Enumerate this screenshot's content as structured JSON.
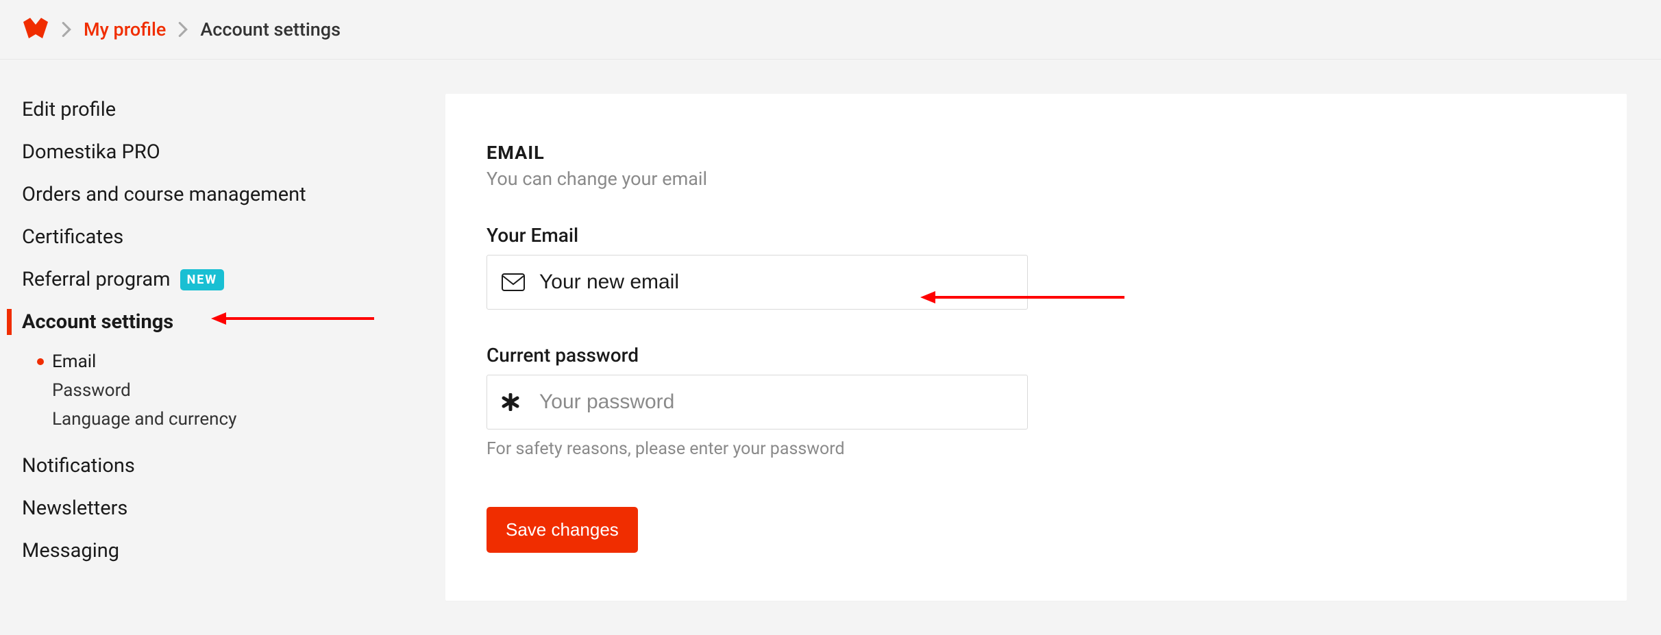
{
  "breadcrumb": {
    "items": [
      {
        "label": "My profile",
        "active": true
      },
      {
        "label": "Account settings",
        "active": false
      }
    ]
  },
  "sidebar": {
    "items": [
      {
        "label": "Edit profile"
      },
      {
        "label": "Domestika PRO"
      },
      {
        "label": "Orders and course management"
      },
      {
        "label": "Certificates"
      },
      {
        "label": "Referral program",
        "badge": "NEW"
      },
      {
        "label": "Account settings",
        "selected": true
      },
      {
        "label": "Notifications"
      },
      {
        "label": "Newsletters"
      },
      {
        "label": "Messaging"
      }
    ],
    "sub_items": [
      {
        "label": "Email",
        "selected": true
      },
      {
        "label": "Password"
      },
      {
        "label": "Language and currency"
      }
    ]
  },
  "main": {
    "section_title": "EMAIL",
    "section_sub": "You can change your email",
    "email": {
      "label": "Your Email",
      "placeholder": "Your new email"
    },
    "password": {
      "label": "Current password",
      "placeholder": "Your password",
      "help": "For safety reasons, please enter your password"
    },
    "save_label": "Save changes"
  },
  "colors": {
    "accent": "#f02d00",
    "badge": "#19bfd3"
  }
}
